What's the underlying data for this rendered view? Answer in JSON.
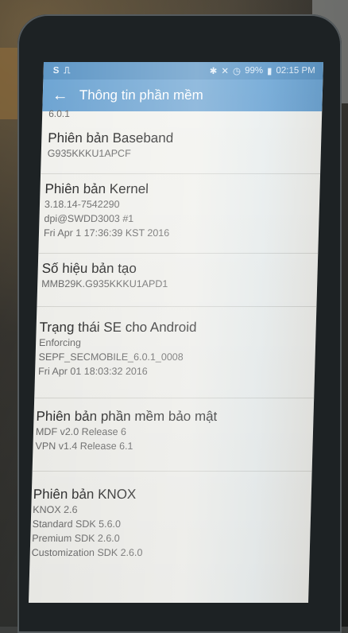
{
  "status_bar": {
    "left_icons": [
      "S",
      "⎍"
    ],
    "battery": "99%",
    "time": "02:15 PM"
  },
  "toolbar": {
    "back_icon": "←",
    "title": "Thông tin phần mềm"
  },
  "partial_top_value": "6.0.1",
  "items": [
    {
      "title": "Phiên bản Baseband",
      "values": [
        "G935KKKU1APCF"
      ]
    },
    {
      "title": "Phiên bản Kernel",
      "values": [
        "3.18.14-7542290",
        "dpi@SWDD3003 #1",
        "Fri Apr 1 17:36:39 KST 2016"
      ]
    },
    {
      "title": "Số hiệu bản tạo",
      "values": [
        "MMB29K.G935KKKU1APD1"
      ]
    },
    {
      "title": "Trạng thái SE cho Android",
      "values": [
        "Enforcing",
        "SEPF_SECMOBILE_6.0.1_0008",
        "Fri Apr 01 18:03:32 2016"
      ]
    },
    {
      "title": "Phiên bản phần mềm bảo mật",
      "values": [
        "MDF v2.0 Release 6",
        "VPN v1.4 Release 6.1"
      ]
    },
    {
      "title": "Phiên bản KNOX",
      "values": [
        "KNOX 2.6",
        "Standard SDK 5.6.0",
        "Premium SDK 2.6.0",
        "Customization SDK 2.6.0"
      ]
    }
  ]
}
